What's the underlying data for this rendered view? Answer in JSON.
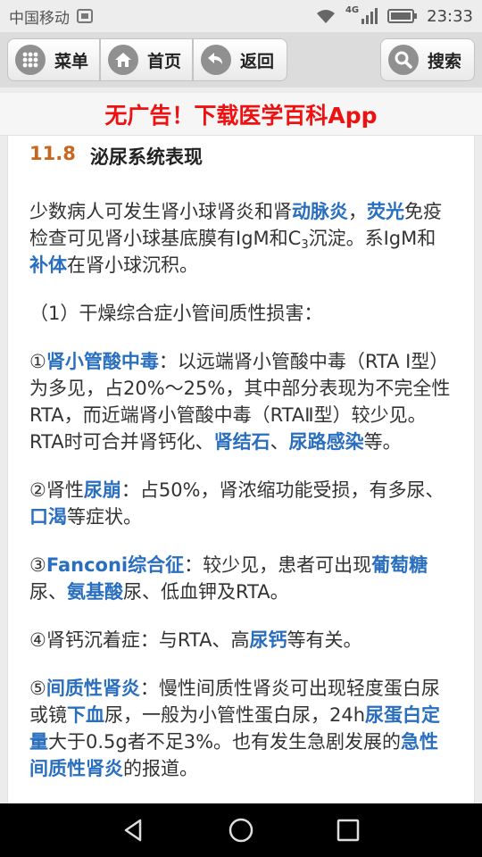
{
  "status_bar": {
    "carrier": "中国移动",
    "network": "4G",
    "time": "23:33"
  },
  "toolbar": {
    "menu_label": "菜单",
    "home_label": "首页",
    "back_label": "返回",
    "search_label": "搜索"
  },
  "banner": {
    "text": "无广告！下载医学百科App"
  },
  "section": {
    "number": "11.8",
    "title": "泌尿系统表现"
  },
  "p1": {
    "t1": "少数病人可发生肾小球肾炎和肾",
    "l1": "动脉炎",
    "t2": "，",
    "l2": "荧光",
    "t3": "免疫检查可见肾小球基底膜有IgM和C",
    "sub": "3",
    "t4": "沉淀。系IgM和",
    "l3": "补体",
    "t5": "在肾小球沉积。"
  },
  "p2": {
    "t1": "（1）干燥综合症小管间质性损害："
  },
  "p3": {
    "t1": "①",
    "l1": "肾小管酸中毒",
    "t2": "：以远端肾小管酸中毒（RTA Ⅰ型）为多见，占20%～25%，其中部分表现为不完全性RTA，而近端肾小管酸中毒（RTAⅡ型）较少见。RTA时可合并肾钙化、",
    "l2": "肾结石",
    "t3": "、",
    "l3": "尿路感染",
    "t4": "等。"
  },
  "p4": {
    "t1": "②肾性",
    "l1": "尿崩",
    "t2": "：占50%，肾浓缩功能受损，有多尿、",
    "l2": "口渴",
    "t3": "等症状。"
  },
  "p5": {
    "t1": "③",
    "l1": "Fanconi综合征",
    "t2": "：较少见，患者可出现",
    "l2": "葡萄糖",
    "t3": "尿、",
    "l3": "氨基酸",
    "t4": "尿、低血钾及RTA。"
  },
  "p6": {
    "t1": "④肾钙沉着症：与RTA、高",
    "l1": "尿钙",
    "t2": "等有关。"
  },
  "p7": {
    "t1": "⑤",
    "l1": "间质性肾炎",
    "t2": "：慢性间质性肾炎可出现轻度蛋白尿或镜",
    "l2": "下血",
    "t3": "尿，一般为小管性蛋白尿，24h",
    "l3": "尿蛋白定量",
    "t4": "大于0.5g者不足3%。也有发生急剧发展的",
    "l4": "急性间质性肾炎",
    "t5": "的报道。"
  }
}
